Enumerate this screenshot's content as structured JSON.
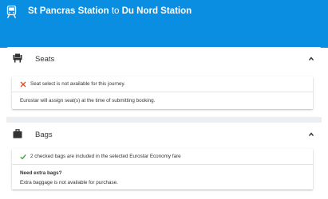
{
  "header": {
    "origin": "St Pancras Station",
    "connector": "to",
    "destination": "Du Nord Station",
    "color": "#0a8ee1"
  },
  "seats": {
    "title": "Seats",
    "icon": "seat-icon",
    "status_icon": "cross-icon",
    "status_text": "Seat select is not available for this journey.",
    "note": "Eurostar will assign seat(s) at the time of submitting booking."
  },
  "bags": {
    "title": "Bags",
    "icon": "suitcase-icon",
    "status_icon": "check-icon",
    "status_text": "2 checked bags are included in the selected Eurostar Economy fare",
    "extra_title": "Need extra bags?",
    "extra_note": "Extra baggage is not available for purchase."
  }
}
